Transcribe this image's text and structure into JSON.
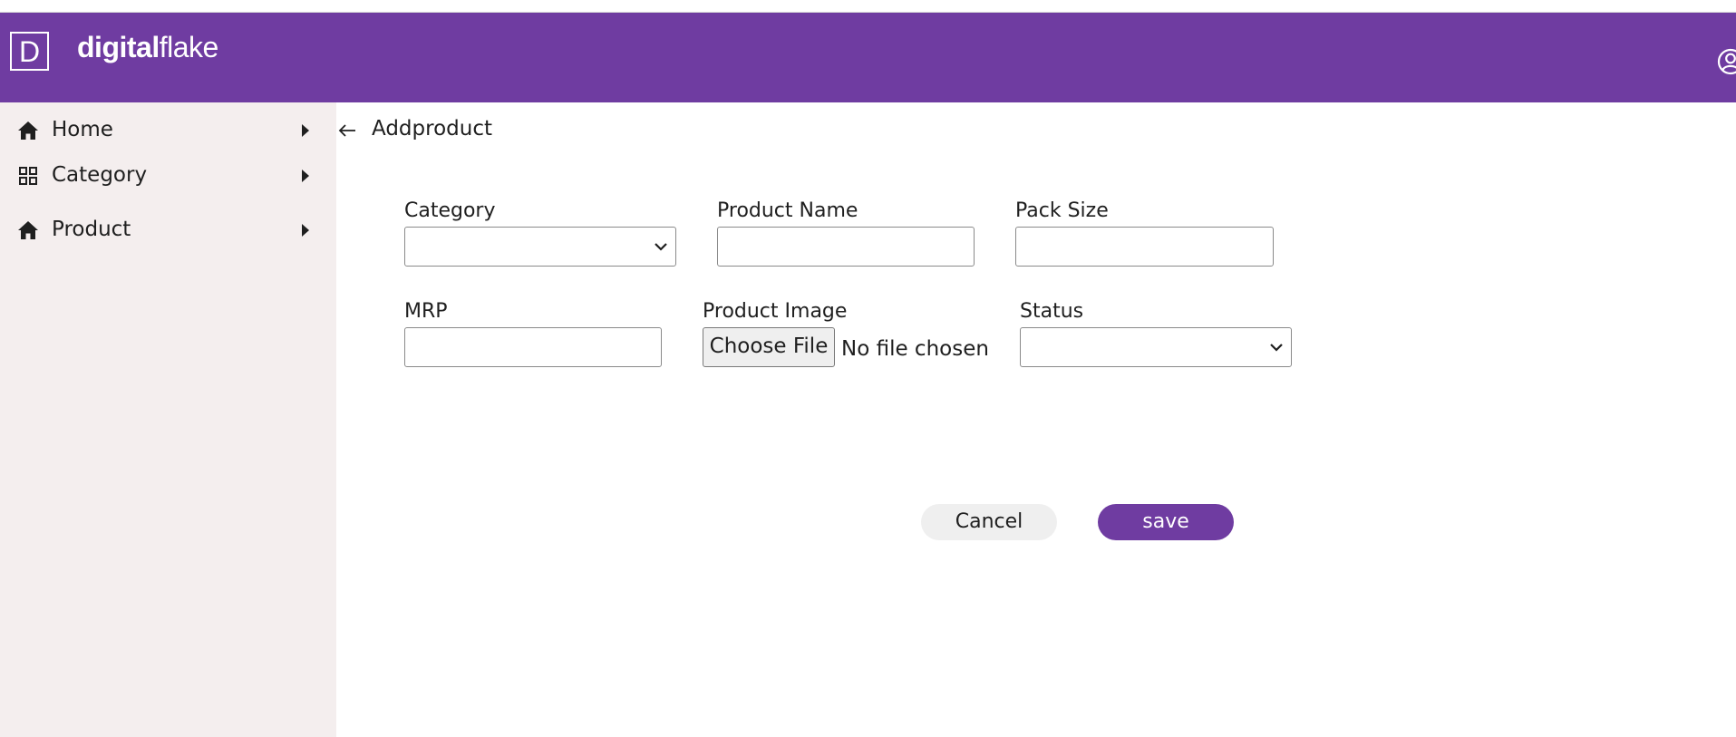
{
  "header": {
    "logo_letter": "D",
    "brand_bold": "digital",
    "brand_light": "flake",
    "brand_color": "#6f3ca1",
    "user_icon": "user-circle-icon"
  },
  "sidebar": {
    "background": "#f4eeee",
    "items": [
      {
        "label": "Home",
        "icon": "home-icon"
      },
      {
        "label": "Category",
        "icon": "grid-icon"
      },
      {
        "label": "Product",
        "icon": "home-icon"
      }
    ]
  },
  "page": {
    "back_icon": "arrow-left-icon",
    "title": "Addproduct"
  },
  "form": {
    "category": {
      "label": "Category",
      "value": ""
    },
    "product_name": {
      "label": "Product Name",
      "value": ""
    },
    "pack_size": {
      "label": "Pack Size",
      "value": ""
    },
    "mrp": {
      "label": "MRP",
      "value": ""
    },
    "product_image": {
      "label": "Product Image",
      "button": "Choose File",
      "status": "No file chosen"
    },
    "status": {
      "label": "Status",
      "value": ""
    }
  },
  "actions": {
    "cancel": "Cancel",
    "save": "save",
    "save_color": "#6f3ca1"
  }
}
